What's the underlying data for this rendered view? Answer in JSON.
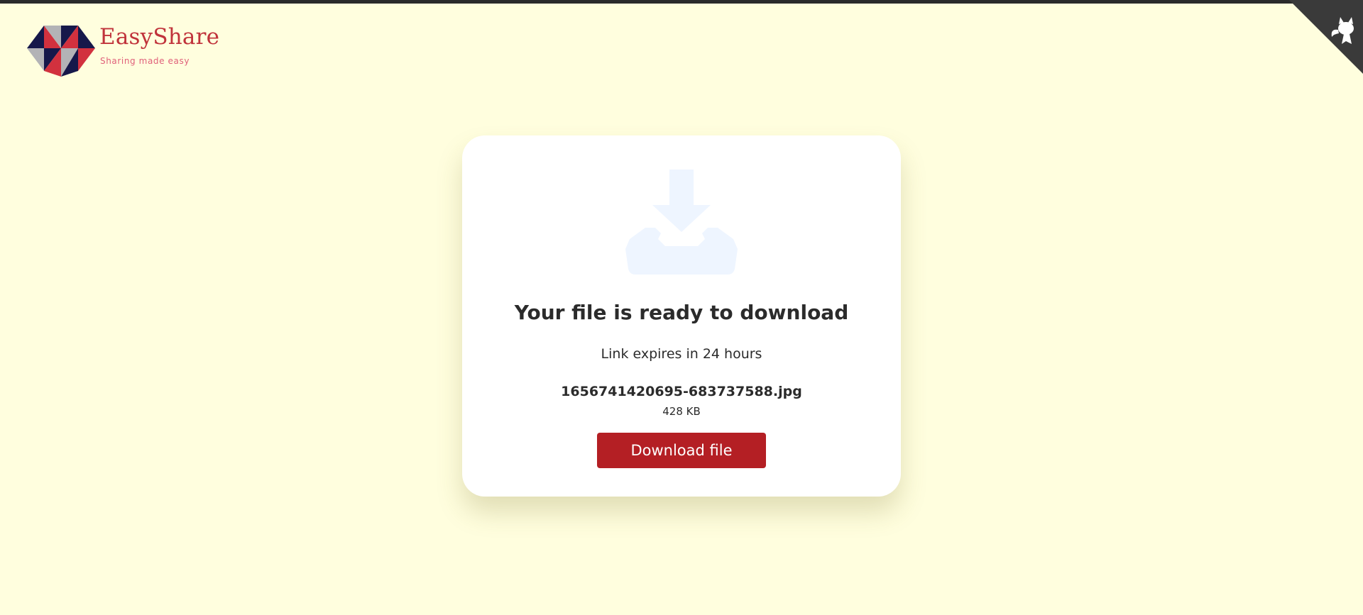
{
  "header": {
    "brand_name": "EasyShare",
    "brand_tagline": "Sharing made easy",
    "logo_colors": {
      "navy": "#16184a",
      "red": "#d2313e",
      "gray": "#b3b3b6",
      "text": "#c0333b"
    },
    "corner_icon": "github-octocat-icon"
  },
  "card": {
    "icon": "download-tray-icon",
    "title": "Your file is ready to download",
    "expiry": "Link expires in 24 hours",
    "file_name": "1656741420695-683737588.jpg",
    "file_size": "428 KB",
    "download_label": "Download file"
  },
  "colors": {
    "background": "#fffede",
    "card": "#ffffff",
    "button": "#b41f24",
    "icon_tint": "#eef5ff",
    "text": "#2b2b2b",
    "corner": "#3a3a3a"
  }
}
